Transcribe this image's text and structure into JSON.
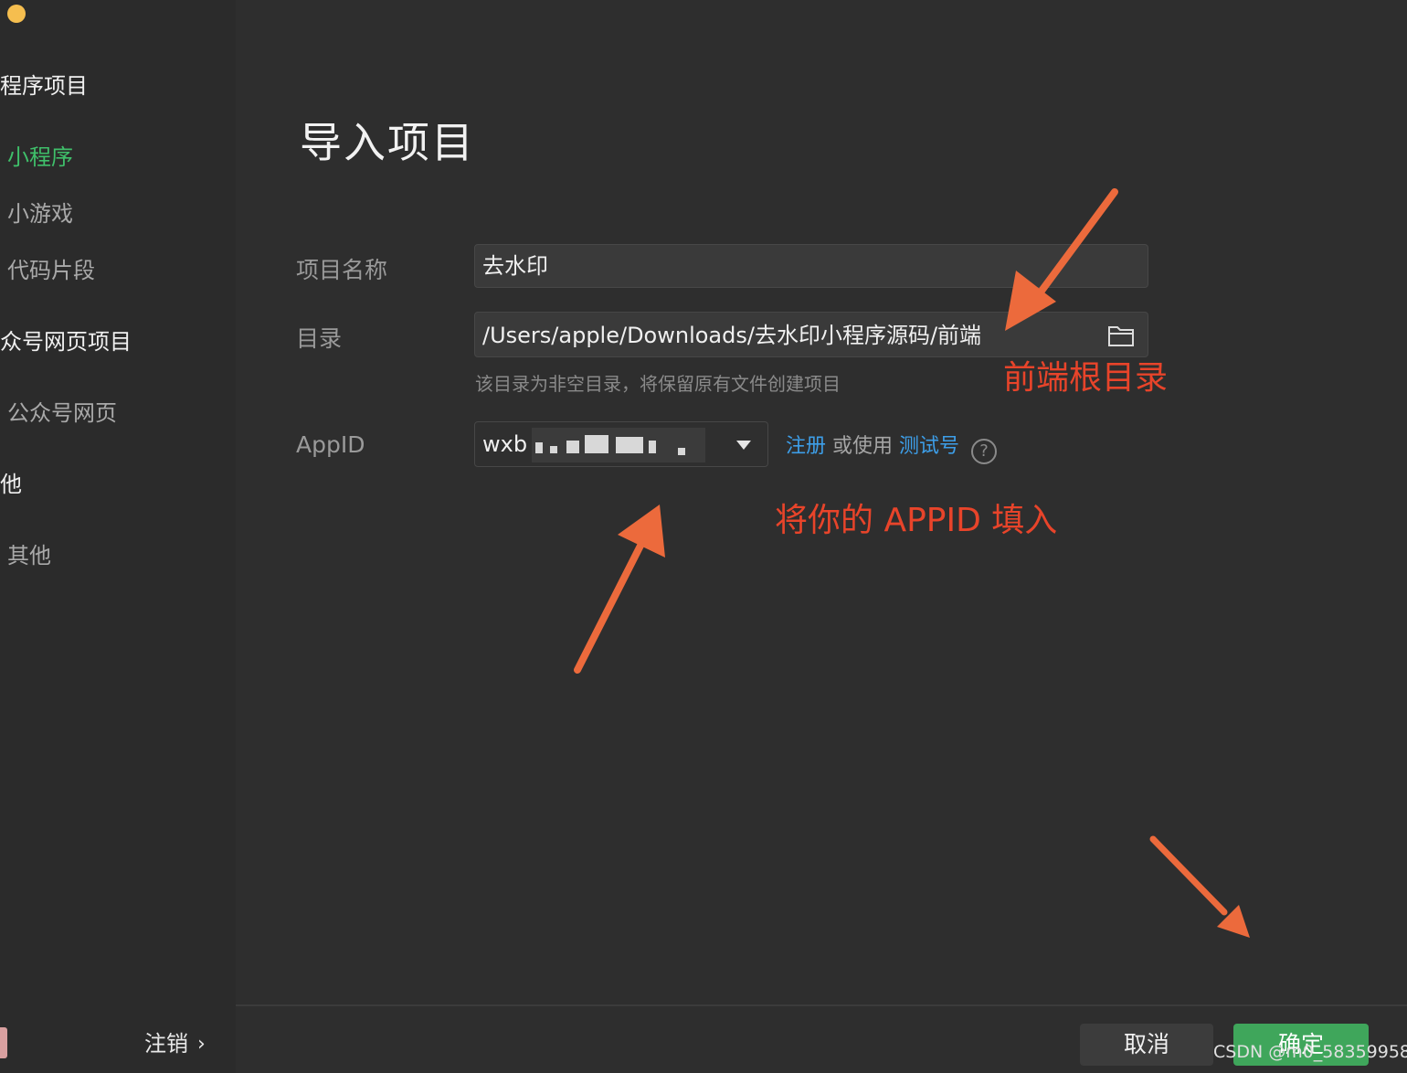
{
  "sidebar": {
    "groups": [
      {
        "title": "程序项目",
        "items": [
          "小程序",
          "小游戏",
          "代码片段"
        ]
      },
      {
        "title": "众号网页项目",
        "items": [
          "公众号网页"
        ]
      },
      {
        "title": "他",
        "items": [
          "其他"
        ]
      }
    ],
    "active_item": "小程序",
    "logout_label": "注销",
    "logout_chevron": "›"
  },
  "main": {
    "title": "导入项目",
    "form": {
      "name_label": "项目名称",
      "name_value": "去水印",
      "dir_label": "目录",
      "dir_value": "/Users/apple/Downloads/去水印小程序源码/前端",
      "dir_hint": "该目录为非空目录，将保留原有文件创建项目",
      "appid_label": "AppID",
      "appid_value_prefix": "wxb",
      "register_link": "注册",
      "or_use": "或使用",
      "test_link": "测试号",
      "help_symbol": "?"
    },
    "buttons": {
      "cancel": "取消",
      "ok": "确定"
    }
  },
  "annotations": {
    "dir_note": "前端根目录",
    "appid_note": "将你的 APPID 填入"
  },
  "watermark": "CSDN @m0_58359958",
  "colors": {
    "accent_green": "#3fbf6a",
    "ok_button": "#3fa65b",
    "link_blue": "#3d9ee8",
    "annotation_red": "#e8442a",
    "arrow_orange": "#ec6a3c"
  },
  "icons": [
    "folder-icon",
    "chevron-down-icon",
    "help-icon",
    "chevron-right-icon"
  ]
}
